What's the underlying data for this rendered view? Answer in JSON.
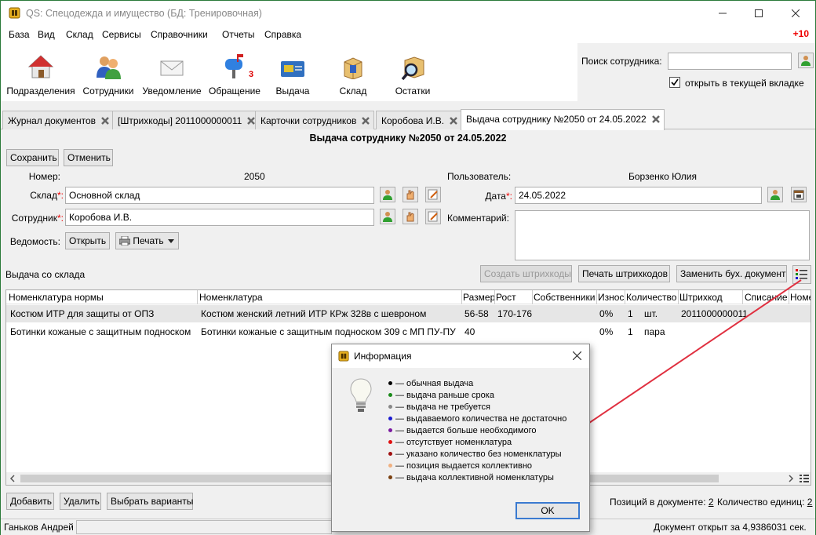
{
  "window": {
    "title": "QS: Спецодежда и имущество (БД: Тренировочная)"
  },
  "menu": {
    "items": [
      "База",
      "Вид",
      "Склад",
      "Сервисы",
      "Справочники",
      "Отчеты",
      "Справка"
    ],
    "notification": "+10"
  },
  "toolbar": {
    "buttons": [
      {
        "label": "Подразделения",
        "icon": "house-icon"
      },
      {
        "label": "Сотрудники",
        "icon": "people-icon"
      },
      {
        "label": "Уведомление",
        "icon": "envelope-icon"
      },
      {
        "label": "Обращение",
        "icon": "mailbox-icon",
        "badge": "3"
      },
      {
        "label": "Выдача",
        "icon": "card-icon"
      },
      {
        "label": "Склад",
        "icon": "box-icon"
      },
      {
        "label": "Остатки",
        "icon": "magnifier-box-icon"
      }
    ]
  },
  "search": {
    "label": "Поиск сотрудника:",
    "value": "",
    "open_in_current_tab_label": "открыть в текущей вкладке",
    "open_in_current_tab_checked": true
  },
  "tabs": [
    {
      "label": "Журнал документов",
      "active": false
    },
    {
      "label": "[Штрихкоды] 2011000000011",
      "active": false
    },
    {
      "label": "Карточки сотрудников",
      "active": false
    },
    {
      "label": "Коробова И.В.",
      "active": false
    },
    {
      "label": "Выдача сотруднику №2050 от 24.05.2022",
      "active": true
    }
  ],
  "document": {
    "title": "Выдача сотруднику №2050 от 24.05.2022",
    "save_label": "Сохранить",
    "cancel_label": "Отменить",
    "number_label": "Номер:",
    "number_value": "2050",
    "warehouse_label": "Склад",
    "warehouse_value": "Основной склад",
    "employee_label": "Сотрудник",
    "employee_value": "Коробова И.В.",
    "statement_label": "Ведомость:",
    "open_label": "Открыть",
    "print_label": "Печать",
    "user_label": "Пользователь:",
    "user_value": "Борзенко Юлия",
    "date_label": "Дата",
    "date_value": "24.05.2022",
    "comment_label": "Комментарий:",
    "comment_value": "",
    "required_mark": "*:",
    "issue_from_label": "Выдача со склада",
    "create_barcodes_label": "Создать штрихкоды",
    "print_barcodes_label": "Печать штрихкодов",
    "replace_doc_label": "Заменить бух. документ"
  },
  "grid": {
    "columns": [
      "Номенклатура нормы",
      "Номенклатура",
      "Размер",
      "Рост",
      "Собственники",
      "Износ",
      "Количество",
      "Штрихкод",
      "Списание",
      "Номе"
    ],
    "rows": [
      {
        "norm": "Костюм ИТР для защиты от ОПЗ",
        "nomenclature": "Костюм женский летний ИТР КРж 328в с шевроном",
        "size": "56-58",
        "height": "170-176",
        "owners": "",
        "wear": "0%",
        "qty": "1",
        "unit": "шт.",
        "barcode": "2011000000011",
        "selected": true
      },
      {
        "norm": "Ботинки кожаные с защитным подноском",
        "nomenclature": "Ботинки кожаные с защитным подноском 309 с МП ПУ-ПУ",
        "size": "40",
        "height": "",
        "owners": "",
        "wear": "0%",
        "qty": "1",
        "unit": "пара",
        "barcode": "",
        "selected": false
      }
    ]
  },
  "bottom": {
    "add_label": "Добавить",
    "delete_label": "Удалить",
    "choose_variants_label": "Выбрать варианты",
    "positions_label": "Позиций в документе:",
    "positions_value": "2",
    "units_label": "Количество единиц:",
    "units_value": "2"
  },
  "status": {
    "user": "Ганьков Андрей",
    "opened_text": "Документ открыт за 4,9386031 сек."
  },
  "dialog": {
    "title": "Информация",
    "ok_label": "OK",
    "legend": [
      {
        "color": "#000000",
        "text": "— обычная выдача"
      },
      {
        "color": "#1a8a1a",
        "text": "— выдача раньше срока"
      },
      {
        "color": "#888888",
        "text": "— выдача не требуется"
      },
      {
        "color": "#1a1ad0",
        "text": "— выдаваемого количества не достаточно"
      },
      {
        "color": "#7a1aa0",
        "text": "— выдается больше необходимого"
      },
      {
        "color": "#e01010",
        "text": "— отсутствует номенклатура"
      },
      {
        "color": "#a01010",
        "text": "— указано количество без номенклатуры"
      },
      {
        "color": "#f0b080",
        "text": "— позиция выдается коллективно"
      },
      {
        "color": "#7a4010",
        "text": "— выдача коллективной номенклатуры"
      }
    ]
  }
}
